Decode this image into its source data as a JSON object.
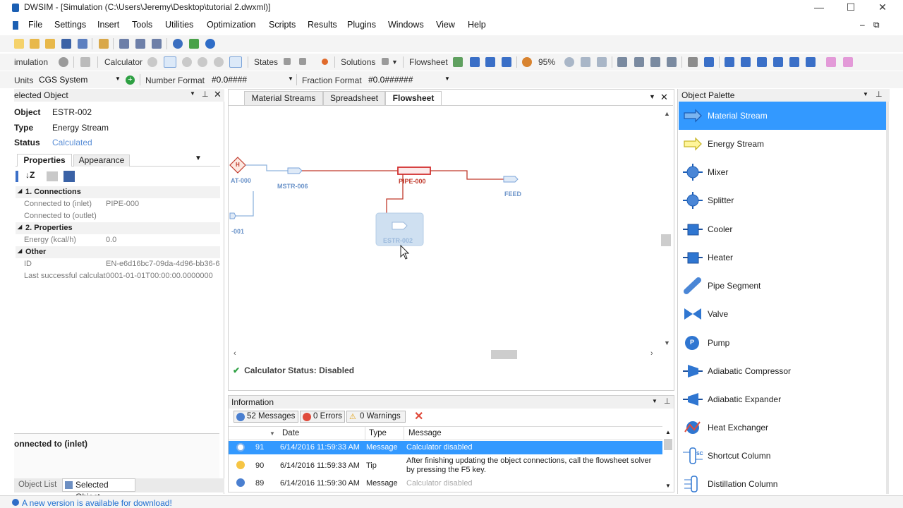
{
  "window": {
    "title": "DWSIM - [Simulation (C:\\Users\\Jeremy\\Desktop\\tutorial 2.dwxml)]",
    "controls": [
      "—",
      "☐",
      "✕"
    ]
  },
  "menu": {
    "items": [
      "File",
      "Settings",
      "Insert",
      "Tools",
      "Utilities",
      "Optimization",
      "Scripts",
      "Results",
      "Plugins",
      "Windows",
      "View",
      "Help"
    ],
    "mdi_controls": [
      "‒",
      "⧉"
    ]
  },
  "toolbar2": {
    "simulation_label": "imulation",
    "calculator_label": "Calculator",
    "states_label": "States",
    "solutions_label": "Solutions",
    "flowsheet_label": "Flowsheet",
    "zoom_value": "95%"
  },
  "toolbar3": {
    "units_label": "Units",
    "units_value": "CGS System",
    "number_format_label": "Number Format",
    "number_format_value": "#0.0####",
    "fraction_format_label": "Fraction Format",
    "fraction_format_value": "#0.0######"
  },
  "selected_object": {
    "header": "elected Object",
    "object_label": "Object",
    "object_value": "ESTR-002",
    "type_label": "Type",
    "type_value": "Energy Stream",
    "status_label": "Status",
    "status_value": "Calculated",
    "tabs": [
      "Properties",
      "Appearance"
    ],
    "grid": {
      "cat1": "1. Connections",
      "inlet_key": "Connected to (inlet)",
      "inlet_val": "PIPE-000",
      "outlet_key": "Connected to (outlet)",
      "outlet_val": "",
      "cat2": "2. Properties",
      "energy_key": "Energy (kcal/h)",
      "energy_val": "0.0",
      "cat3": "Other",
      "id_key": "ID",
      "id_val": "EN-e6d16bc7-09da-4d96-bb36-6",
      "last_key": "Last successful calculat",
      "last_val": "0001-01-01T00:00:00.0000000"
    },
    "description_title": "onnected to (inlet)",
    "bottom_tabs": [
      "Object List",
      "Selected Object"
    ]
  },
  "flowsheet": {
    "tabs": [
      "Material Streams",
      "Spreadsheet",
      "Flowsheet"
    ],
    "labels": {
      "heater": "AT-000",
      "mstr": "MSTR-006",
      "pipe": "PIPE-000",
      "feed": "FEED",
      "estr": "ESTR-002",
      "left_stub": "-001"
    },
    "heater_letter": "H",
    "calc_status": "Calculator Status: Disabled"
  },
  "information": {
    "header": "Information",
    "badges": [
      "52 Messages",
      "0 Errors",
      "0 Warnings"
    ],
    "columns": [
      "Date",
      "Type",
      "Message"
    ],
    "rows": [
      {
        "num": "91",
        "date": "6/14/2016 11:59:33 AM",
        "type": "Message",
        "message": "Calculator disabled"
      },
      {
        "num": "90",
        "date": "6/14/2016 11:59:33 AM",
        "type": "Tip",
        "message": "After finishing updating the object connections, call the flowsheet solver",
        "message2": "by pressing the F5 key."
      },
      {
        "num": "89",
        "date": "6/14/2016 11:59:30 AM",
        "type": "Message",
        "message": "Calculator disabled"
      }
    ]
  },
  "palette": {
    "header": "Object Palette",
    "items": [
      "Material Stream",
      "Energy Stream",
      "Mixer",
      "Splitter",
      "Cooler",
      "Heater",
      "Pipe Segment",
      "Valve",
      "Pump",
      "Adiabatic Compressor",
      "Adiabatic Expander",
      "Heat Exchanger",
      "Shortcut Column",
      "Distillation Column"
    ],
    "shortcut_glyph": "SC",
    "pump_glyph": "P"
  },
  "statusbar": {
    "text": "A new version is available for download!"
  },
  "colors": {
    "selection": "#3399ff",
    "stream_red": "#c0392b",
    "stream_blue": "#8fb4dd",
    "status_blue": "#1f6fd1"
  }
}
